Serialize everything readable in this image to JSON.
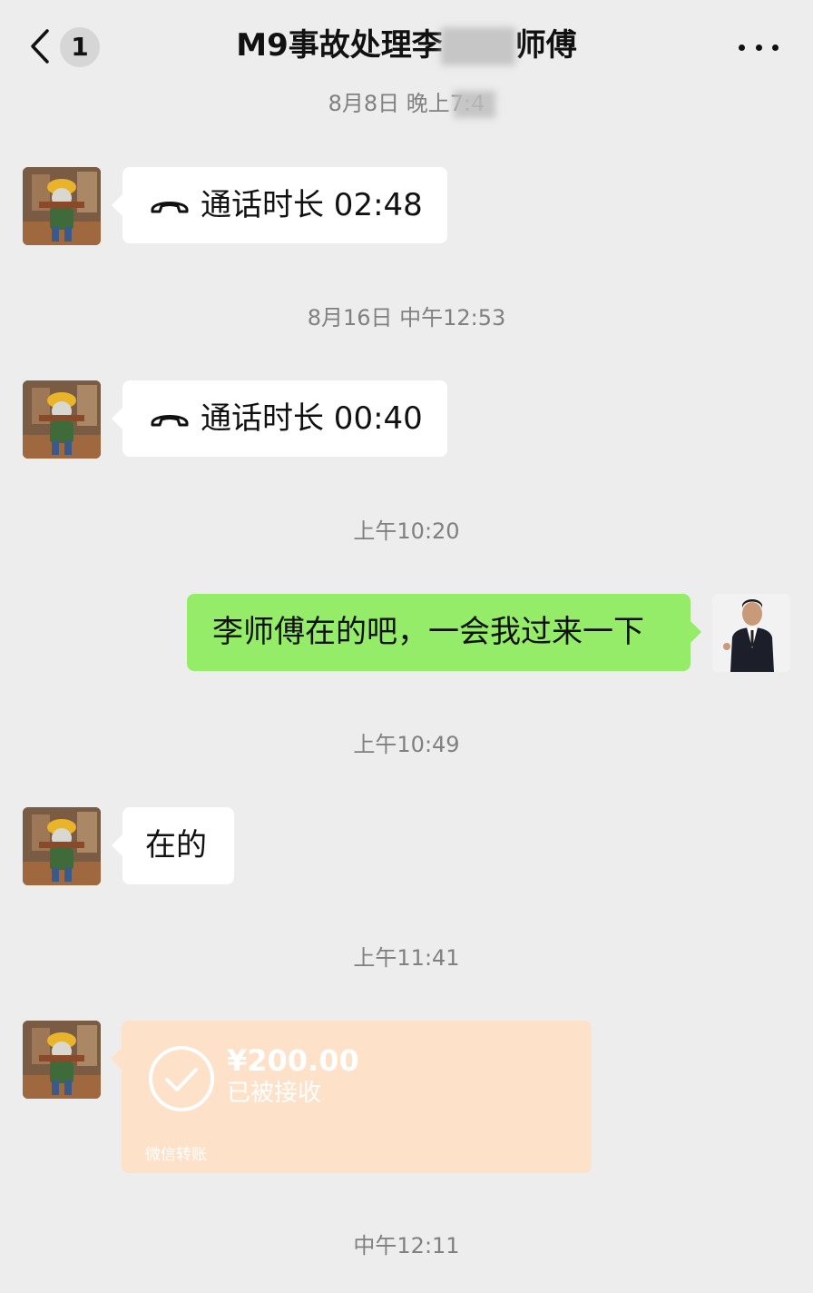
{
  "header": {
    "unread_count": "1",
    "title": "M9事故处理李建华师傅",
    "title_visible": "M9事故处理李",
    "title_suffix": "师傅"
  },
  "messages": [
    {
      "type": "timestamp",
      "text": "8月8日 晚上7:4"
    },
    {
      "type": "call",
      "sender": "contact",
      "label": "通话时长 02:48"
    },
    {
      "type": "timestamp",
      "text": "8月16日 中午12:53"
    },
    {
      "type": "call",
      "sender": "contact",
      "label": "通话时长 00:40"
    },
    {
      "type": "timestamp",
      "text": "上午10:20"
    },
    {
      "type": "text",
      "sender": "me",
      "text": "李师傅在的吧，一会我过来一下"
    },
    {
      "type": "timestamp",
      "text": "上午10:49"
    },
    {
      "type": "text",
      "sender": "contact",
      "text": "在的"
    },
    {
      "type": "timestamp",
      "text": "上午11:41"
    },
    {
      "type": "transfer",
      "sender": "contact",
      "amount": "¥200.00",
      "status": "已被接收",
      "label": "微信转账"
    },
    {
      "type": "timestamp",
      "text": "中午12:11"
    }
  ],
  "colors": {
    "background": "#ededed",
    "bubble_me": "#95ec69",
    "bubble_contact": "#ffffff",
    "transfer_received": "#fde1c8",
    "timestamp_text": "#808080"
  },
  "icons": {
    "back": "chevron-left-icon",
    "more": "more-dots-icon",
    "call": "phone-hangup-icon",
    "transfer_status": "check-circle-icon"
  }
}
